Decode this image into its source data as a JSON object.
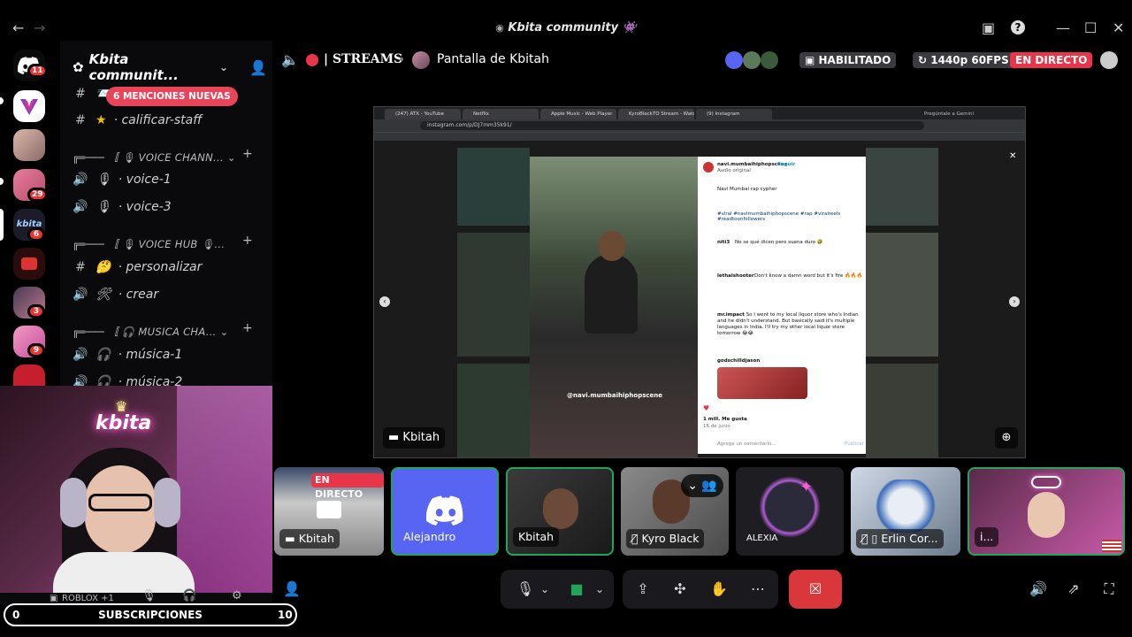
{
  "window": {
    "title": "Kbita community",
    "title_emoji": "👾"
  },
  "guilds": {
    "dm_badge": "11",
    "items": [
      {
        "name": "guild-v",
        "badge": ""
      },
      {
        "name": "guild-photo-1",
        "badge": ""
      },
      {
        "name": "guild-photo-2",
        "badge": "29"
      },
      {
        "name": "guild-kbita",
        "badge": "6"
      },
      {
        "name": "guild-aaa",
        "badge": ""
      },
      {
        "name": "guild-photo-3",
        "badge": "3"
      },
      {
        "name": "guild-photo-4",
        "badge": "9"
      },
      {
        "name": "guild-red",
        "badge": ""
      }
    ]
  },
  "server": {
    "name": "Kbita communit...",
    "mention_pill": "6 MENCIONES NUEVAS",
    "channels": [
      {
        "type": "text",
        "label": "",
        "icon": "#",
        "emoji": "📨"
      },
      {
        "type": "text",
        "label": "· calificar-staff",
        "icon": "#",
        "emoji": "★"
      },
      {
        "type": "category",
        "label": "╔═─── 〚 🎙 VOICE CHANN..."
      },
      {
        "type": "voice",
        "label": "· voice-1",
        "emoji": "🎙"
      },
      {
        "type": "voice",
        "label": "· voice-3",
        "emoji": "🎙"
      },
      {
        "type": "category",
        "label": "╔═─── 〚 🎙 VOICE HUB 🎙..."
      },
      {
        "type": "text",
        "label": "· personalizar",
        "icon": "#",
        "emoji": "🤔"
      },
      {
        "type": "voice",
        "label": "· crear",
        "emoji": "🛠"
      },
      {
        "type": "category",
        "label": "╔═─── 〚 🎧 MUSICA CHA..."
      },
      {
        "type": "voice",
        "label": "· música-1",
        "emoji": "🎧"
      },
      {
        "type": "voice",
        "label": "· música-2",
        "emoji": "🎧"
      }
    ]
  },
  "header": {
    "channel": "| STREAMS",
    "stream_title": "Pantalla de Kbitah",
    "enabled": "HABILITADO",
    "quality": "1440p 60FPS",
    "live": "EN DIRECTO"
  },
  "browser": {
    "tabs": [
      "(247) ATX - YouTube",
      "Netflix",
      "Apple Music - Web Player",
      "KyroBlackTO Stream - Watch",
      "(9) Instagram"
    ],
    "url": "instagram.com/p/DJ7mm35k91/",
    "gemini": "Pregúntale a Gemini",
    "post": {
      "account": "navi.mumbaihiphopscene",
      "follow": "Seguir",
      "audio": "Audio original",
      "caption": "Navi Mumbai rap cypher",
      "hashtags": "#viral #navimumbaihiphopscene #rap #viralreels #readtoonfollowers",
      "c1_user": "niti3",
      "c1_text": "No se qué dicen pero suena duro 🤣",
      "c2_user": "lethalshooter",
      "c2_text": "Don't know a damn word but it's fire 🔥🔥🔥",
      "c3_user": "mr.impact",
      "c3_text": "So I went to my local liquor store who's Indian and he didn't understand. But basically said it's multiple languages in India. I'll try my other local liquor store tomorrow 😂😂",
      "c4_user": "godschilldjason",
      "likes": "1 mill. Me gusta",
      "date": "16 de junio",
      "comment_placeholder": "Agrega un comentario...",
      "publish": "Publicar",
      "watermark": "@navi.mumbaihiphopscene"
    }
  },
  "stream_label": "Kbitah",
  "tiles": [
    {
      "label": "Kbitah",
      "badge": "EN DIRECTO"
    },
    {
      "label": "Alejandro"
    },
    {
      "label": "Kbitah"
    },
    {
      "label": "Kyro Black"
    },
    {
      "label": "ALEXIA"
    },
    {
      "label": "Erlin Cor..."
    },
    {
      "label": "i..."
    }
  ],
  "cam": {
    "neon": "kbita",
    "activity": "ROBLOX +1"
  },
  "subs": {
    "left": "0",
    "label": "SUBSCRIPCIONES",
    "right": "10"
  },
  "colors": {
    "accent": "#5865f2",
    "live": "#e8354a",
    "green": "#23a559",
    "hangup": "#da373c"
  }
}
